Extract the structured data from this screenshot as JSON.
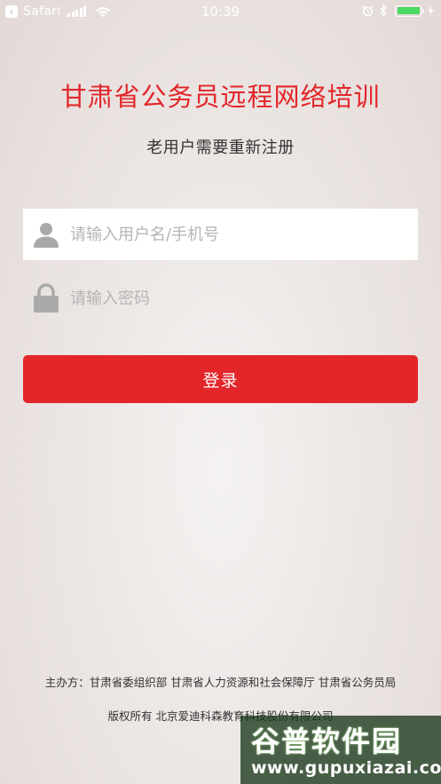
{
  "status_bar": {
    "carrier": "Safari",
    "time": "10:39",
    "battery_color": "#4cd964"
  },
  "header": {
    "title": "甘肃省公务员远程网络培训",
    "subtitle": "老用户需要重新注册"
  },
  "form": {
    "username_placeholder": "请输入用户名/手机号",
    "username_value": "",
    "password_placeholder": "请输入密码",
    "password_value": "",
    "login_label": "登录"
  },
  "footer": {
    "sponsor": "主办方：甘肃省委组织部 甘肃省人力资源和社会保障厅 甘肃省公务员局",
    "copyright": "版权所有 北京爱迪科森教育科技股份有限公司"
  },
  "watermark": {
    "cn": "谷普软件园",
    "url": "www.gupuxiazai.com"
  },
  "colors": {
    "accent": "#e3262a"
  }
}
